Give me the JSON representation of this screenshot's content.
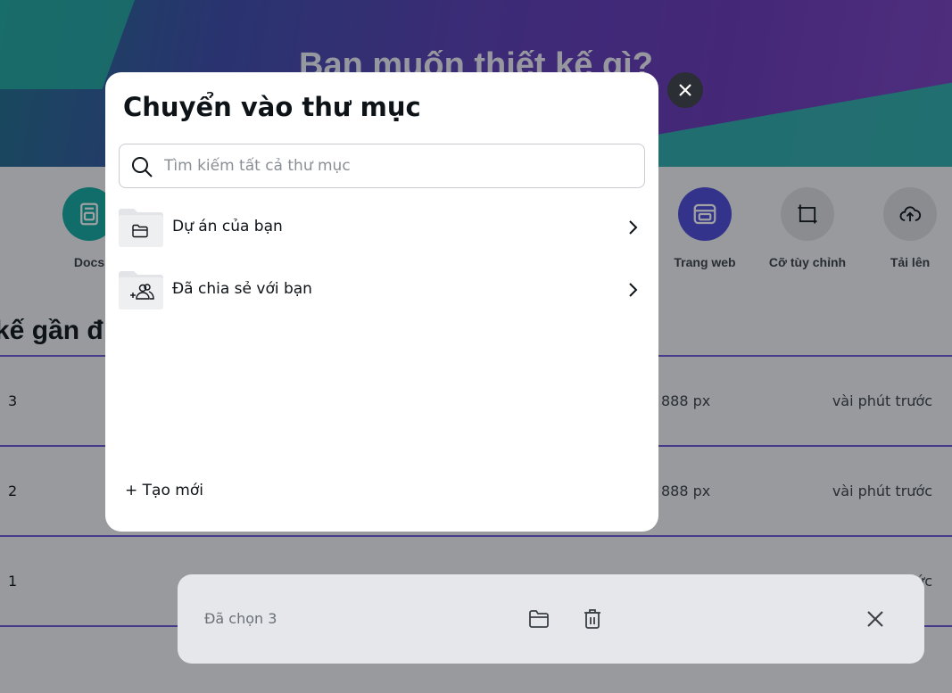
{
  "hero": {
    "title": "Bạn muốn thiết kế gì?"
  },
  "shortcuts": [
    {
      "label": "Docs",
      "icon": "docs-icon",
      "color": "#13a89e"
    },
    {
      "label": "Trang web",
      "icon": "website-icon",
      "color": "#4b49d8"
    },
    {
      "label": "Cỡ tùy chỉnh",
      "icon": "custom-size-icon",
      "color": "#dcdde0"
    },
    {
      "label": "Tải lên",
      "icon": "upload-cloud-icon",
      "color": "#dcdde0"
    }
  ],
  "recent": {
    "title": "kế gần đ",
    "rows": [
      {
        "num": "3",
        "size": "888 px",
        "time": "vài phút trước"
      },
      {
        "num": "2",
        "size": "888 px",
        "time": "vài phút trước"
      },
      {
        "num": "1",
        "size": "",
        "time": "ức"
      }
    ]
  },
  "selection_bar": {
    "count_label": "Đã chọn 3",
    "icons": [
      "folder-icon",
      "trash-icon",
      "close-icon"
    ]
  },
  "modal": {
    "title": "Chuyển vào thư mục",
    "search_placeholder": "Tìm kiếm tất cả thư mục",
    "folders": [
      {
        "name": "Dự án của bạn",
        "icon": "folder-icon"
      },
      {
        "name": "Đã chia sẻ với bạn",
        "icon": "shared-users-icon"
      }
    ],
    "create_new": "+ Tạo mới"
  },
  "colors": {
    "accent": "#6c55d8",
    "overlay": "rgba(14,19,24,0.40)",
    "modal_bg": "#ffffff"
  }
}
